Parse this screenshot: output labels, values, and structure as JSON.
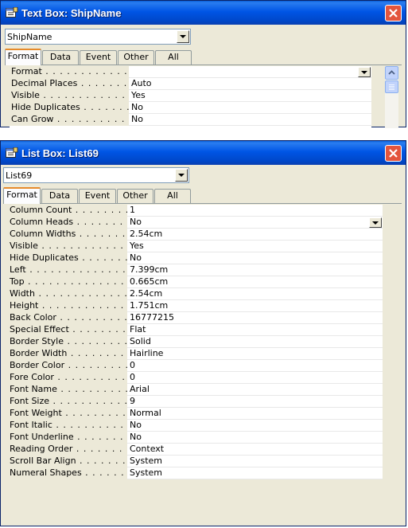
{
  "window1": {
    "title": "Text Box: ShipName",
    "combo_value": "ShipName",
    "tabs": [
      "Format",
      "Data",
      "Event",
      "Other",
      "All"
    ],
    "active_tab": "Format",
    "rows": [
      {
        "name": "Format",
        "dots": " . . . . . . . . . . . . . . .",
        "value": ""
      },
      {
        "name": "Decimal Places",
        "dots": " . . . . . . . . . .",
        "value": "Auto"
      },
      {
        "name": "Visible",
        "dots": " . . . . . . . . . . . . . . . .",
        "value": "Yes"
      },
      {
        "name": "Hide Duplicates",
        "dots": " . . . . . . . . .",
        "value": "No"
      },
      {
        "name": "Can Grow",
        "dots": " . . . . . . . . . . . . .",
        "value": "No"
      }
    ]
  },
  "window2": {
    "title": "List Box: List69",
    "combo_value": "List69",
    "tabs": [
      "Format",
      "Data",
      "Event",
      "Other",
      "All"
    ],
    "active_tab": "Format",
    "rows": [
      {
        "name": "Column Count",
        "dots": " . . . . . . . . . . .",
        "value": "1"
      },
      {
        "name": "Column Heads",
        "dots": " . . . . . . . . . . .",
        "value": "No"
      },
      {
        "name": "Column Widths",
        "dots": " . . . . . . . . . .",
        "value": "2.54cm"
      },
      {
        "name": "Visible",
        "dots": " . . . . . . . . . . . . . . . .",
        "value": "Yes"
      },
      {
        "name": "Hide Duplicates",
        "dots": " . . . . . . . . . .",
        "value": "No"
      },
      {
        "name": "Left",
        "dots": " . . . . . . . . . . . . . . . . . .",
        "value": "7.399cm"
      },
      {
        "name": "Top",
        "dots": " . . . . . . . . . . . . . . . . . .",
        "value": "0.665cm"
      },
      {
        "name": "Width",
        "dots": " . . . . . . . . . . . . . . . . .",
        "value": "2.54cm"
      },
      {
        "name": "Height",
        "dots": " . . . . . . . . . . . . . . . .",
        "value": "1.751cm"
      },
      {
        "name": "Back Color",
        "dots": " . . . . . . . . . . . . .",
        "value": "16777215"
      },
      {
        "name": "Special Effect",
        "dots": " . . . . . . . . . . .",
        "value": "Flat"
      },
      {
        "name": "Border Style",
        "dots": " . . . . . . . . . . . .",
        "value": "Solid"
      },
      {
        "name": "Border Width",
        "dots": " . . . . . . . . . . . .",
        "value": "Hairline"
      },
      {
        "name": "Border Color",
        "dots": " . . . . . . . . . . . .",
        "value": "0"
      },
      {
        "name": "Fore Color",
        "dots": " . . . . . . . . . . . . . .",
        "value": "0"
      },
      {
        "name": "Font Name",
        "dots": " . . . . . . . . . . . . . .",
        "value": "Arial"
      },
      {
        "name": "Font Size",
        "dots": " . . . . . . . . . . . . . .",
        "value": "9"
      },
      {
        "name": "Font Weight",
        "dots": " . . . . . . . . . . . .",
        "value": "Normal"
      },
      {
        "name": "Font Italic",
        "dots": " . . . . . . . . . . . . . .",
        "value": "No"
      },
      {
        "name": "Font Underline",
        "dots": " . . . . . . . . . .",
        "value": "No"
      },
      {
        "name": "Reading Order",
        "dots": " . . . . . . . . . .",
        "value": "Context"
      },
      {
        "name": "Scroll Bar Align",
        "dots": " . . . . . . . . .",
        "value": "System"
      },
      {
        "name": "Numeral Shapes",
        "dots": " . . . . . . . . .",
        "value": "System"
      }
    ]
  },
  "colors": {
    "titlebar": "#0055e5",
    "dialog_bg": "#ece9d8",
    "close_button": "#e3553d",
    "active_tab_accent": "#e68b2c"
  },
  "icons": [
    "properties-window-icon",
    "close-icon",
    "dropdown-arrow-icon",
    "scroll-up-arrow-icon"
  ]
}
